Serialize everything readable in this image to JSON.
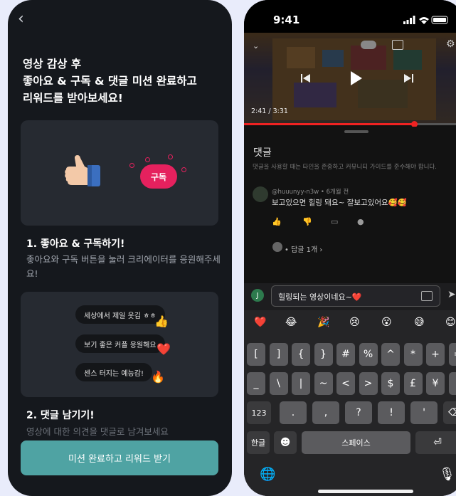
{
  "left": {
    "headline": [
      "영상 감상 후",
      "좋아요 & 구독 & 댓글 미션 완료하고",
      "리워드를 받아보세요!"
    ],
    "subscribe_label": "구독",
    "step1": {
      "title": "1. 좋아요 & 구독하기!",
      "desc": "좋아요와 구독 버튼을 눌러 크리에이터를 응원해주세요!"
    },
    "bubbles": [
      {
        "text": "세상에서 제일 웃김 ㅎㅎ",
        "emoji": "👍"
      },
      {
        "text": "보기 좋은 커플 응원해요",
        "emoji": "❤️"
      },
      {
        "text": "센스 터지는 예능감!",
        "emoji": "🔥"
      }
    ],
    "step2": {
      "title": "2. 댓글 남기기!",
      "desc": "영상에 대한 의견을 댓글로 남겨보세요"
    },
    "cta": "미션 완료하고 리워드 받기"
  },
  "right": {
    "status_time": "9:41",
    "video": {
      "time": "2:41 / 3:31",
      "progress": 0.77
    },
    "comments": {
      "title": "댓글",
      "notice": "댓글을 사용할 때는 타인을 존중하고 커뮤니티 가이드를 준수해야 합니다.",
      "author_meta": "@huuunyy-n3w • 6개월 전",
      "text": "보고있으면 힐링 돼요~ 잘보고있어요🥰🥰",
      "replies": "• 답글 1개 ›"
    },
    "input": {
      "avatar": "J",
      "value": "힐링되는 영상이네요~❤️"
    },
    "emoji_row": [
      "❤️",
      "😂",
      "🎉",
      "😢",
      "😮",
      "😅",
      "😊"
    ],
    "keyboard": {
      "row1": [
        "[",
        "]",
        "{",
        "}",
        "#",
        "%",
        "^",
        "*",
        "+",
        "="
      ],
      "row2": [
        "_",
        "\\",
        "|",
        "~",
        "<",
        ">",
        "$",
        "£",
        "¥",
        "•"
      ],
      "row3": [
        "123",
        ".",
        ",",
        "?",
        "!",
        "'",
        "⌫"
      ],
      "row4": [
        "한글",
        "☻",
        "스페이스",
        "⏎"
      ],
      "globe": "🌐",
      "mic": "🎙"
    }
  }
}
